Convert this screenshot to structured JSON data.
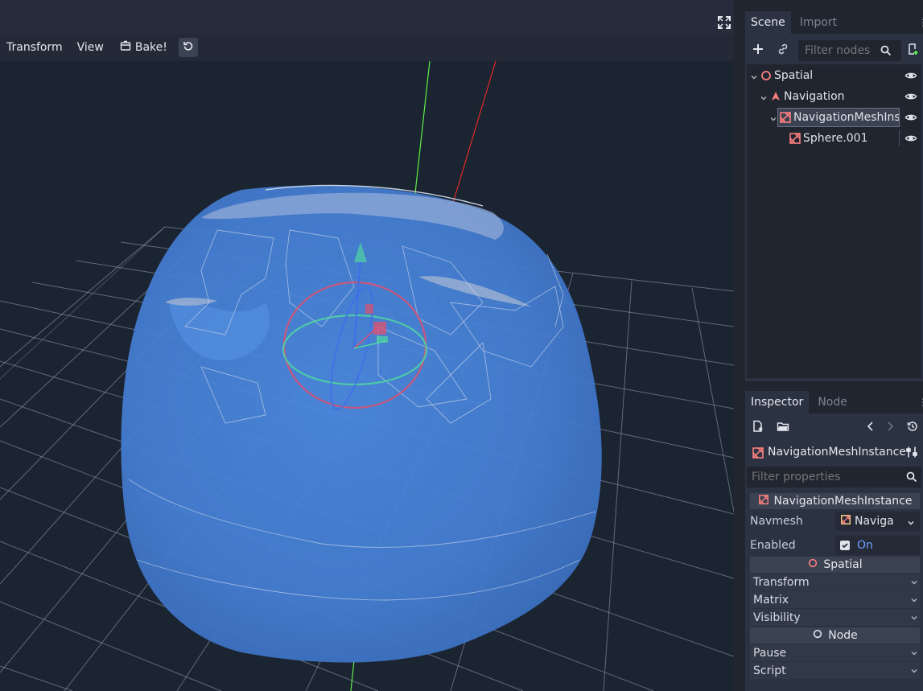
{
  "toolbar": {
    "transform_label": "Transform",
    "view_label": "View",
    "bake_label": "Bake!"
  },
  "scene_dock": {
    "tabs": [
      {
        "label": "Scene",
        "active": true
      },
      {
        "label": "Import",
        "active": false
      }
    ],
    "filter_placeholder": "Filter nodes",
    "tree": [
      {
        "label": "Spatial",
        "icon": "spatial-icon",
        "depth": 0,
        "expanded": true,
        "selected": false
      },
      {
        "label": "Navigation",
        "icon": "navigation-icon",
        "depth": 1,
        "expanded": true,
        "selected": false
      },
      {
        "label": "NavigationMeshInst",
        "icon": "navmesh-instance-icon",
        "depth": 2,
        "expanded": true,
        "selected": true
      },
      {
        "label": "Sphere.001",
        "icon": "mesh-instance-icon",
        "depth": 3,
        "expanded": false,
        "selected": false
      }
    ]
  },
  "inspector_dock": {
    "tabs": [
      {
        "label": "Inspector",
        "active": true
      },
      {
        "label": "Node",
        "active": false
      }
    ],
    "object_name": "NavigationMeshInstance",
    "filter_placeholder": "Filter properties",
    "class_header": "NavigationMeshInstance",
    "navmesh_label": "Navmesh",
    "navmesh_value": "Naviga",
    "enabled_label": "Enabled",
    "enabled_value": "On",
    "spatial_header": "Spatial",
    "spatial_groups": [
      "Transform",
      "Matrix",
      "Visibility"
    ],
    "node_header": "Node",
    "node_groups": [
      "Pause",
      "Script"
    ]
  },
  "colors": {
    "accent": "#6ea1ff",
    "mesh_blue": "#4a86de",
    "gizmo_red": "#e0506e",
    "gizmo_green": "#4fd6a0",
    "axis_green": "#5ef04a",
    "axis_red": "#e02a2a",
    "node_red": "#fc7f7f"
  }
}
